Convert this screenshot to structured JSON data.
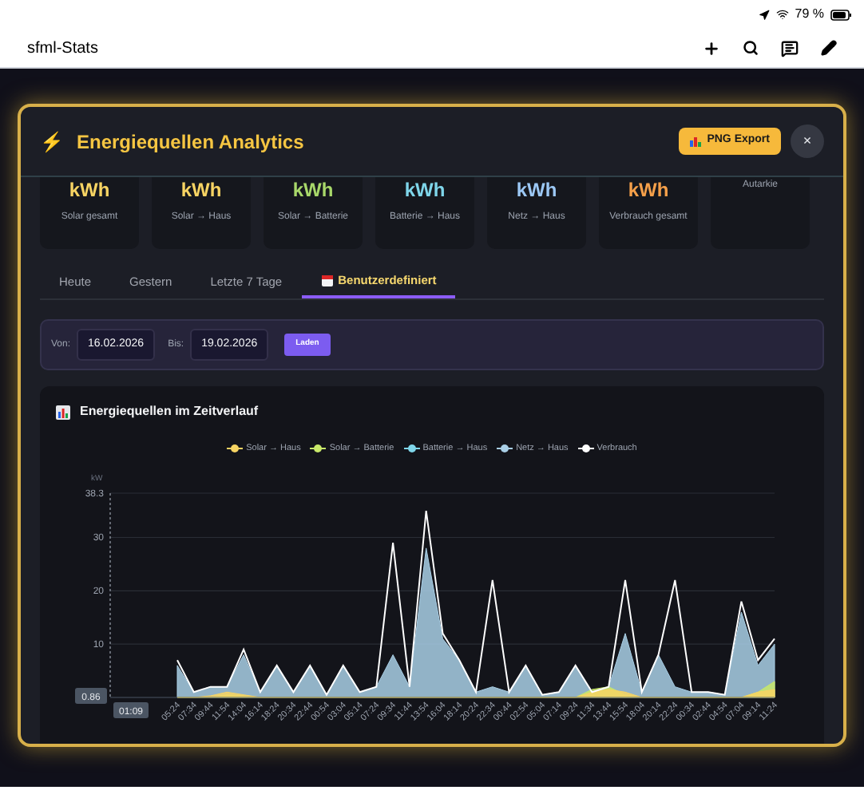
{
  "status_bar": {
    "battery": "79 %"
  },
  "app_bar": {
    "title": "sfml-Stats"
  },
  "dialog": {
    "icon": "⚡",
    "title": "Energiequellen Analytics",
    "export_button": "PNG Export",
    "close": "×"
  },
  "stat_cards": [
    {
      "unit": "kWh",
      "label": "Solar gesamt",
      "color": "#f7d463"
    },
    {
      "unit": "kWh",
      "label": "Solar → Haus",
      "color": "#f7d463"
    },
    {
      "unit": "kWh",
      "label": "Solar → Batterie",
      "color": "#a8d86a"
    },
    {
      "unit": "kWh",
      "label": "Batterie → Haus",
      "color": "#7fd6ea"
    },
    {
      "unit": "kWh",
      "label": "Netz → Haus",
      "color": "#9cc8f5"
    },
    {
      "unit": "kWh",
      "label": "Verbrauch gesamt",
      "color": "#f5a04a"
    },
    {
      "label": "Autarkie"
    }
  ],
  "tabs": [
    {
      "label": "Heute",
      "selected": false,
      "kind": "plain"
    },
    {
      "label": "Gestern",
      "selected": false,
      "kind": "plain"
    },
    {
      "label": "Letzte 7 Tage",
      "selected": false,
      "kind": "plain"
    },
    {
      "label": "Benutzerdefiniert",
      "selected": true,
      "kind": "dated"
    }
  ],
  "date_filter": {
    "from_label": "Von:",
    "from": "16.02.2026",
    "to_label": "Bis:",
    "to": "19.02.2026",
    "load_button": "Laden"
  },
  "chart_panel": {
    "title": "Energiequellen im Zeitverlauf",
    "crosshair": {
      "value": "0.86",
      "time": "01:09"
    },
    "chart_data": {
      "type": "area",
      "grid": true,
      "ylabel": "kW",
      "ylim": [
        0,
        38.3
      ],
      "yticks": [
        10,
        20,
        30,
        38.3
      ],
      "x": [
        "05:24",
        "07:34",
        "09:44",
        "11:54",
        "14:04",
        "16:14",
        "18:24",
        "20:34",
        "22:44",
        "00:54",
        "03:04",
        "05:14",
        "07:24",
        "09:34",
        "11:44",
        "13:54",
        "16:04",
        "18:14",
        "20:24",
        "22:34",
        "00:44",
        "02:54",
        "05:04",
        "07:14",
        "09:24",
        "11:34",
        "13:44",
        "15:54",
        "18:04",
        "20:14",
        "22:24",
        "00:34",
        "02:44",
        "04:54",
        "07:04",
        "09:14",
        "11:24"
      ],
      "series": [
        {
          "name": "Solar → Haus",
          "type": "area",
          "color": "#f7d463",
          "values": [
            0,
            0,
            0.3,
            1,
            0.5,
            0,
            0,
            0,
            0,
            0,
            0,
            0,
            0,
            0,
            0,
            0,
            0,
            0,
            0,
            0,
            0,
            0,
            0,
            0,
            0,
            1,
            1.5,
            1,
            0,
            0,
            0,
            0,
            0,
            0,
            0,
            1,
            1.5
          ]
        },
        {
          "name": "Solar → Batterie",
          "type": "area",
          "color": "#c8e86a",
          "values": [
            0,
            0,
            0,
            0.5,
            0.3,
            0,
            0,
            0,
            0,
            0,
            0,
            0,
            0,
            0,
            0,
            0,
            0,
            0,
            0,
            0,
            0,
            0,
            0,
            0,
            0,
            1.5,
            2,
            0.5,
            0,
            0,
            0,
            0,
            0,
            0,
            0,
            1,
            3
          ]
        },
        {
          "name": "Batterie → Haus",
          "type": "area",
          "color": "#7fd6ea",
          "values": [
            0,
            0,
            0,
            0,
            0,
            0,
            0,
            0,
            0,
            0,
            0,
            0,
            0,
            0,
            0,
            0,
            0,
            0,
            0,
            0,
            0,
            0,
            0,
            0,
            0,
            0,
            0.5,
            0,
            0,
            0,
            0,
            0,
            0,
            0,
            0,
            0,
            0
          ]
        },
        {
          "name": "Netz → Haus",
          "type": "area",
          "color": "#a9cfe6",
          "values": [
            6,
            1,
            2,
            2,
            8,
            1,
            6,
            1,
            6,
            0.5,
            6,
            1,
            2,
            8,
            2,
            28,
            11,
            7,
            1,
            2,
            1,
            6,
            0.5,
            1,
            6,
            1,
            2,
            12,
            1,
            8,
            2,
            1,
            1,
            0.5,
            16,
            6,
            10
          ]
        },
        {
          "name": "Verbrauch",
          "type": "line",
          "color": "#ffffff",
          "values": [
            7,
            1,
            2,
            2,
            9,
            1,
            6,
            1,
            6,
            0.5,
            6,
            1,
            2,
            29,
            2,
            35,
            12,
            7,
            1,
            22,
            1,
            6,
            0.5,
            1,
            6,
            1,
            2,
            22,
            1,
            8,
            22,
            1,
            1,
            0.5,
            18,
            7,
            11
          ]
        }
      ]
    }
  }
}
